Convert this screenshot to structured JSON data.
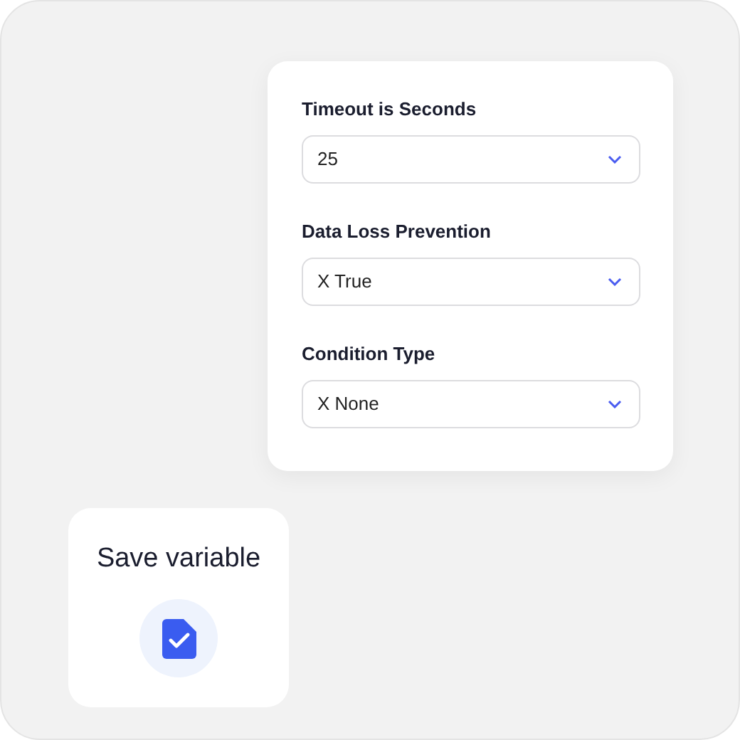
{
  "settings_panel": {
    "fields": [
      {
        "label": "Timeout is Seconds",
        "value": "25"
      },
      {
        "label": "Data Loss Prevention",
        "value": "X True"
      },
      {
        "label": "Condition Type",
        "value": "X None"
      }
    ]
  },
  "save_card": {
    "title": "Save variable"
  }
}
